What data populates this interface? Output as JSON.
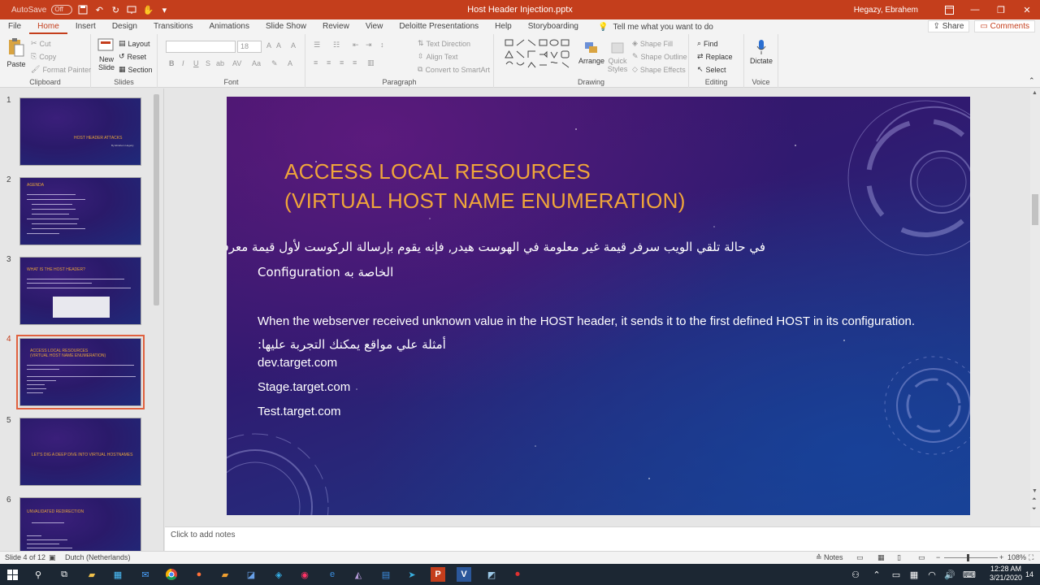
{
  "window": {
    "autosave_label": "AutoSave",
    "autosave_state": "Off",
    "title": "Host Header Injection.pptx",
    "user": "Hegazy, Ebrahem"
  },
  "menu": {
    "tabs": [
      "File",
      "Home",
      "Insert",
      "Design",
      "Transitions",
      "Animations",
      "Slide Show",
      "Review",
      "View",
      "Deloitte Presentations",
      "Help",
      "Storyboarding"
    ],
    "active_tab": "Home",
    "tell_me": "Tell me what you want to do",
    "share": "Share",
    "comments": "Comments"
  },
  "ribbon": {
    "clipboard": {
      "label": "Clipboard",
      "paste": "Paste",
      "cut": "Cut",
      "copy": "Copy",
      "format_painter": "Format Painter"
    },
    "slides": {
      "label": "Slides",
      "new_slide": "New Slide",
      "layout": "Layout",
      "reset": "Reset",
      "section": "Section"
    },
    "font": {
      "label": "Font",
      "size": "18"
    },
    "paragraph": {
      "label": "Paragraph",
      "text_direction": "Text Direction",
      "align_text": "Align Text",
      "smartart": "Convert to SmartArt"
    },
    "drawing": {
      "label": "Drawing",
      "arrange": "Arrange",
      "quick_styles": "Quick Styles",
      "shape_fill": "Shape Fill",
      "shape_outline": "Shape Outline",
      "shape_effects": "Shape Effects"
    },
    "editing": {
      "label": "Editing",
      "find": "Find",
      "replace": "Replace",
      "select": "Select"
    },
    "voice": {
      "label": "Voice",
      "dictate": "Dictate"
    }
  },
  "thumbnails": [
    {
      "num": "1",
      "title": "HOST HEADER ATTACKS",
      "subtitle": "By Ebrahem Hegazy"
    },
    {
      "num": "2",
      "title": "AGENDA"
    },
    {
      "num": "3",
      "title": "WHAT IS THE HOST HEADER?"
    },
    {
      "num": "4",
      "title": "ACCESS LOCAL RESOURCES",
      "title2": "(VIRTUAL HOST NAME ENUMERATION)"
    },
    {
      "num": "5",
      "title": "LET'S DIG A DEEP DIVE INTO VIRTUAL HOSTNAMES"
    },
    {
      "num": "6",
      "title": "UNVALIDATED REDIRECTION"
    }
  ],
  "slide": {
    "title_line1": "ACCESS LOCAL RESOURCES",
    "title_line2": "(VIRTUAL HOST NAME ENUMERATION)",
    "arabic_line1": "في حالة تلقي الويب سرفر قيمة غير معلومة في الهوست هيدر, فإنه يقوم بإرسالة الركوست لأول قيمة معرفه في ال",
    "arabic_line2": "Configuration الخاصة به",
    "english": "When the webserver received unknown value in the HOST header, it sends it to the first defined HOST in its configuration.",
    "arabic_examples": "أمثلة علي مواقع يمكنك التجربة عليها:",
    "examples": [
      "dev.target.com",
      "Stage.target.com",
      "Test.target.com"
    ]
  },
  "notes_placeholder": "Click to add notes",
  "status": {
    "slide_of": "Slide 4 of 12",
    "language": "Dutch (Netherlands)",
    "notes": "Notes",
    "zoom": "108%"
  },
  "clock": {
    "time": "12:28 AM",
    "date": "3/21/2020",
    "notif": "14"
  }
}
